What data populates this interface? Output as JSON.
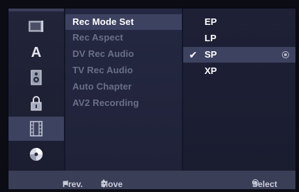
{
  "menu": {
    "items": [
      {
        "label": "Rec Mode Set",
        "active": true
      },
      {
        "label": "Rec Aspect",
        "active": false
      },
      {
        "label": "DV Rec Audio",
        "active": false
      },
      {
        "label": "TV Rec Audio",
        "active": false
      },
      {
        "label": "Auto Chapter",
        "active": false
      },
      {
        "label": "AV2 Recording",
        "active": false
      }
    ]
  },
  "options": {
    "items": [
      {
        "label": "EP",
        "selected": false
      },
      {
        "label": "LP",
        "selected": false
      },
      {
        "label": "SP",
        "selected": true
      },
      {
        "label": "XP",
        "selected": false
      }
    ]
  },
  "sidebar": {
    "icons": [
      "tv-setup-icon",
      "language-icon",
      "audio-speaker-icon",
      "lock-icon",
      "recording-film-icon",
      "disc-icon"
    ],
    "selected": "recording-film-icon"
  },
  "footer": {
    "prev": "Prev.",
    "move": "Move",
    "select": "Select"
  },
  "colors": {
    "highlight": "#3d4261",
    "inactive_text": "#6a6f88",
    "text": "#ffffff"
  }
}
